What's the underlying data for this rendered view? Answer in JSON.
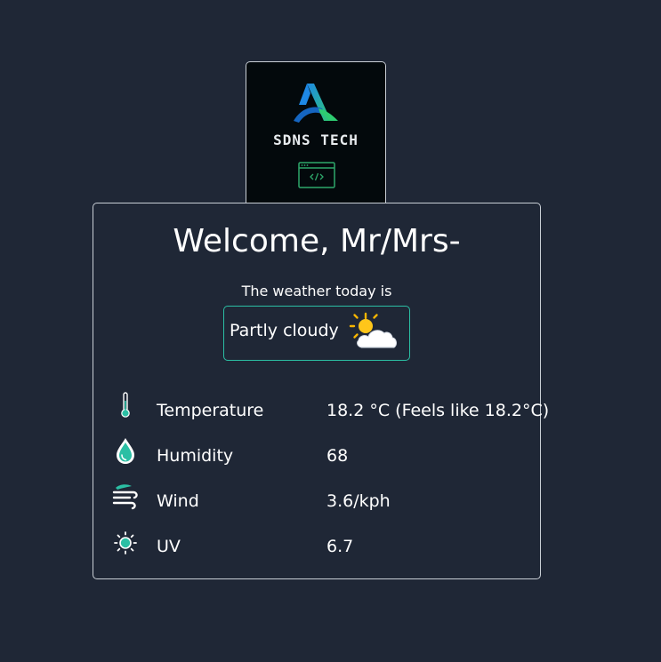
{
  "logo": {
    "brand_text": "SDNS TECH",
    "brand_icon": "triangle-logo-icon",
    "code_icon": "code-window-icon",
    "colors": {
      "blue": "#1e88e5",
      "green": "#2ecc71",
      "code": "#2ea86b"
    }
  },
  "greeting": {
    "title": "Welcome, Mr/Mrs-"
  },
  "weather": {
    "intro": "The weather today is",
    "condition": "Partly cloudy",
    "condition_icon": "partly-cloudy-icon"
  },
  "stats": [
    {
      "icon": "thermometer-icon",
      "label": "Temperature",
      "value": "18.2 °C (Feels like 18.2°C)"
    },
    {
      "icon": "water-drop-icon",
      "label": "Humidity",
      "value": "68"
    },
    {
      "icon": "wind-icon",
      "label": "Wind",
      "value": "3.6/kph"
    },
    {
      "icon": "sun-uv-icon",
      "label": "UV",
      "value": "6.7"
    }
  ],
  "colors": {
    "background": "#1f2736",
    "accent": "#2bbfa4",
    "border": "#c9cfd6"
  }
}
